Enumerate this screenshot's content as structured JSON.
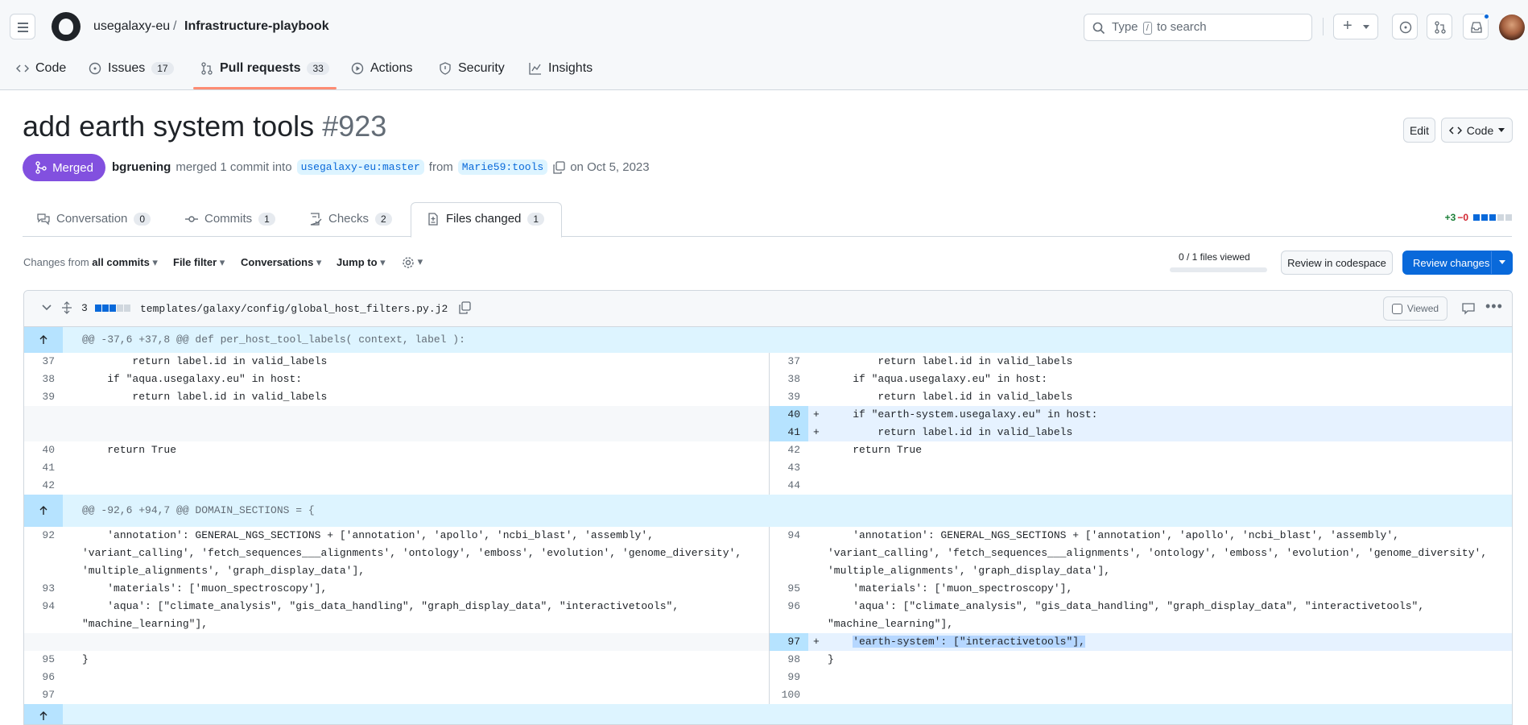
{
  "header": {
    "owner": "usegalaxy-eu",
    "separator": "/",
    "repo": "Infrastructure-playbook",
    "search_prefix": "Type",
    "search_key": "/",
    "search_suffix": "to search",
    "plus_label": "+"
  },
  "repo_tabs": [
    {
      "label": "Code"
    },
    {
      "label": "Issues",
      "count": "17"
    },
    {
      "label": "Pull requests",
      "count": "33"
    },
    {
      "label": "Actions"
    },
    {
      "label": "Security"
    },
    {
      "label": "Insights"
    }
  ],
  "pr": {
    "title": "add earth system tools",
    "number": "#923",
    "edit_label": "Edit",
    "code_label": "Code",
    "state": "Merged",
    "author": "bgruening",
    "action": "merged 1 commit into",
    "base": "usegalaxy-eu:master",
    "from_word": "from",
    "head": "Marie59:tools",
    "date": "on Oct 5, 2023"
  },
  "pr_tabs": [
    {
      "label": "Conversation",
      "count": "0"
    },
    {
      "label": "Commits",
      "count": "1"
    },
    {
      "label": "Checks",
      "count": "2"
    },
    {
      "label": "Files changed",
      "count": "1"
    }
  ],
  "diffstat": {
    "added": "+3",
    "removed": "−0"
  },
  "toolbar": {
    "changes_from_prefix": "Changes from",
    "changes_from_value": "all commits",
    "file_filter": "File filter",
    "conversations": "Conversations",
    "jump_to": "Jump to",
    "files_viewed": "0 / 1 files viewed",
    "files_viewed_fraction": 0,
    "review_codespace": "Review in codespace",
    "review_changes": "Review changes"
  },
  "file": {
    "changes": "3",
    "path": "templates/galaxy/config/global_host_filters.py.j2",
    "viewed_label": "Viewed",
    "hunks": [
      "@@ -37,6 +37,8 @@ def per_host_tool_labels( context, label ):",
      "@@ -92,6 +94,7 @@ DOMAIN_SECTIONS = {"
    ],
    "rows": [
      {
        "l": "37",
        "lc": "        return label.id in valid_labels",
        "r": "37",
        "rc": "        return label.id in valid_labels"
      },
      {
        "l": "38",
        "lc": "    if \"aqua.usegalaxy.eu\" in host:",
        "r": "38",
        "rc": "    if \"aqua.usegalaxy.eu\" in host:"
      },
      {
        "l": "39",
        "lc": "        return label.id in valid_labels",
        "r": "39",
        "rc": "        return label.id in valid_labels"
      },
      {
        "l": "",
        "lc": "",
        "r": "40",
        "rc": "    if \"earth-system.usegalaxy.eu\" in host:",
        "add": true
      },
      {
        "l": "",
        "lc": "",
        "r": "41",
        "rc": "        return label.id in valid_labels",
        "add": true
      },
      {
        "l": "40",
        "lc": "    return True",
        "r": "42",
        "rc": "    return True"
      },
      {
        "l": "41",
        "lc": "",
        "r": "43",
        "rc": ""
      },
      {
        "l": "42",
        "lc": "",
        "r": "44",
        "rc": ""
      },
      {
        "l": "92",
        "lc": "    'annotation': GENERAL_NGS_SECTIONS + ['annotation', 'apollo', 'ncbi_blast', 'assembly', 'variant_calling', 'fetch_sequences___alignments', 'ontology', 'emboss', 'evolution', 'genome_diversity', 'multiple_alignments', 'graph_display_data'],",
        "r": "94",
        "rc": "    'annotation': GENERAL_NGS_SECTIONS + ['annotation', 'apollo', 'ncbi_blast', 'assembly', 'variant_calling', 'fetch_sequences___alignments', 'ontology', 'emboss', 'evolution', 'genome_diversity', 'multiple_alignments', 'graph_display_data'],"
      },
      {
        "l": "93",
        "lc": "    'materials': ['muon_spectroscopy'],",
        "r": "95",
        "rc": "    'materials': ['muon_spectroscopy'],"
      },
      {
        "l": "94",
        "lc": "    'aqua': [\"climate_analysis\", \"gis_data_handling\", \"graph_display_data\", \"interactivetools\", \"machine_learning\"],",
        "r": "96",
        "rc": "    'aqua': [\"climate_analysis\", \"gis_data_handling\", \"graph_display_data\", \"interactivetools\", \"machine_learning\"],"
      },
      {
        "l": "",
        "lc": "",
        "r": "97",
        "rc": "'earth-system': [\"interactivetools\"],",
        "add": true
      },
      {
        "l": "95",
        "lc": "}",
        "r": "98",
        "rc": "}"
      },
      {
        "l": "96",
        "lc": "",
        "r": "99",
        "rc": ""
      },
      {
        "l": "97",
        "lc": "",
        "r": "100",
        "rc": ""
      }
    ],
    "add_sign": "+"
  }
}
